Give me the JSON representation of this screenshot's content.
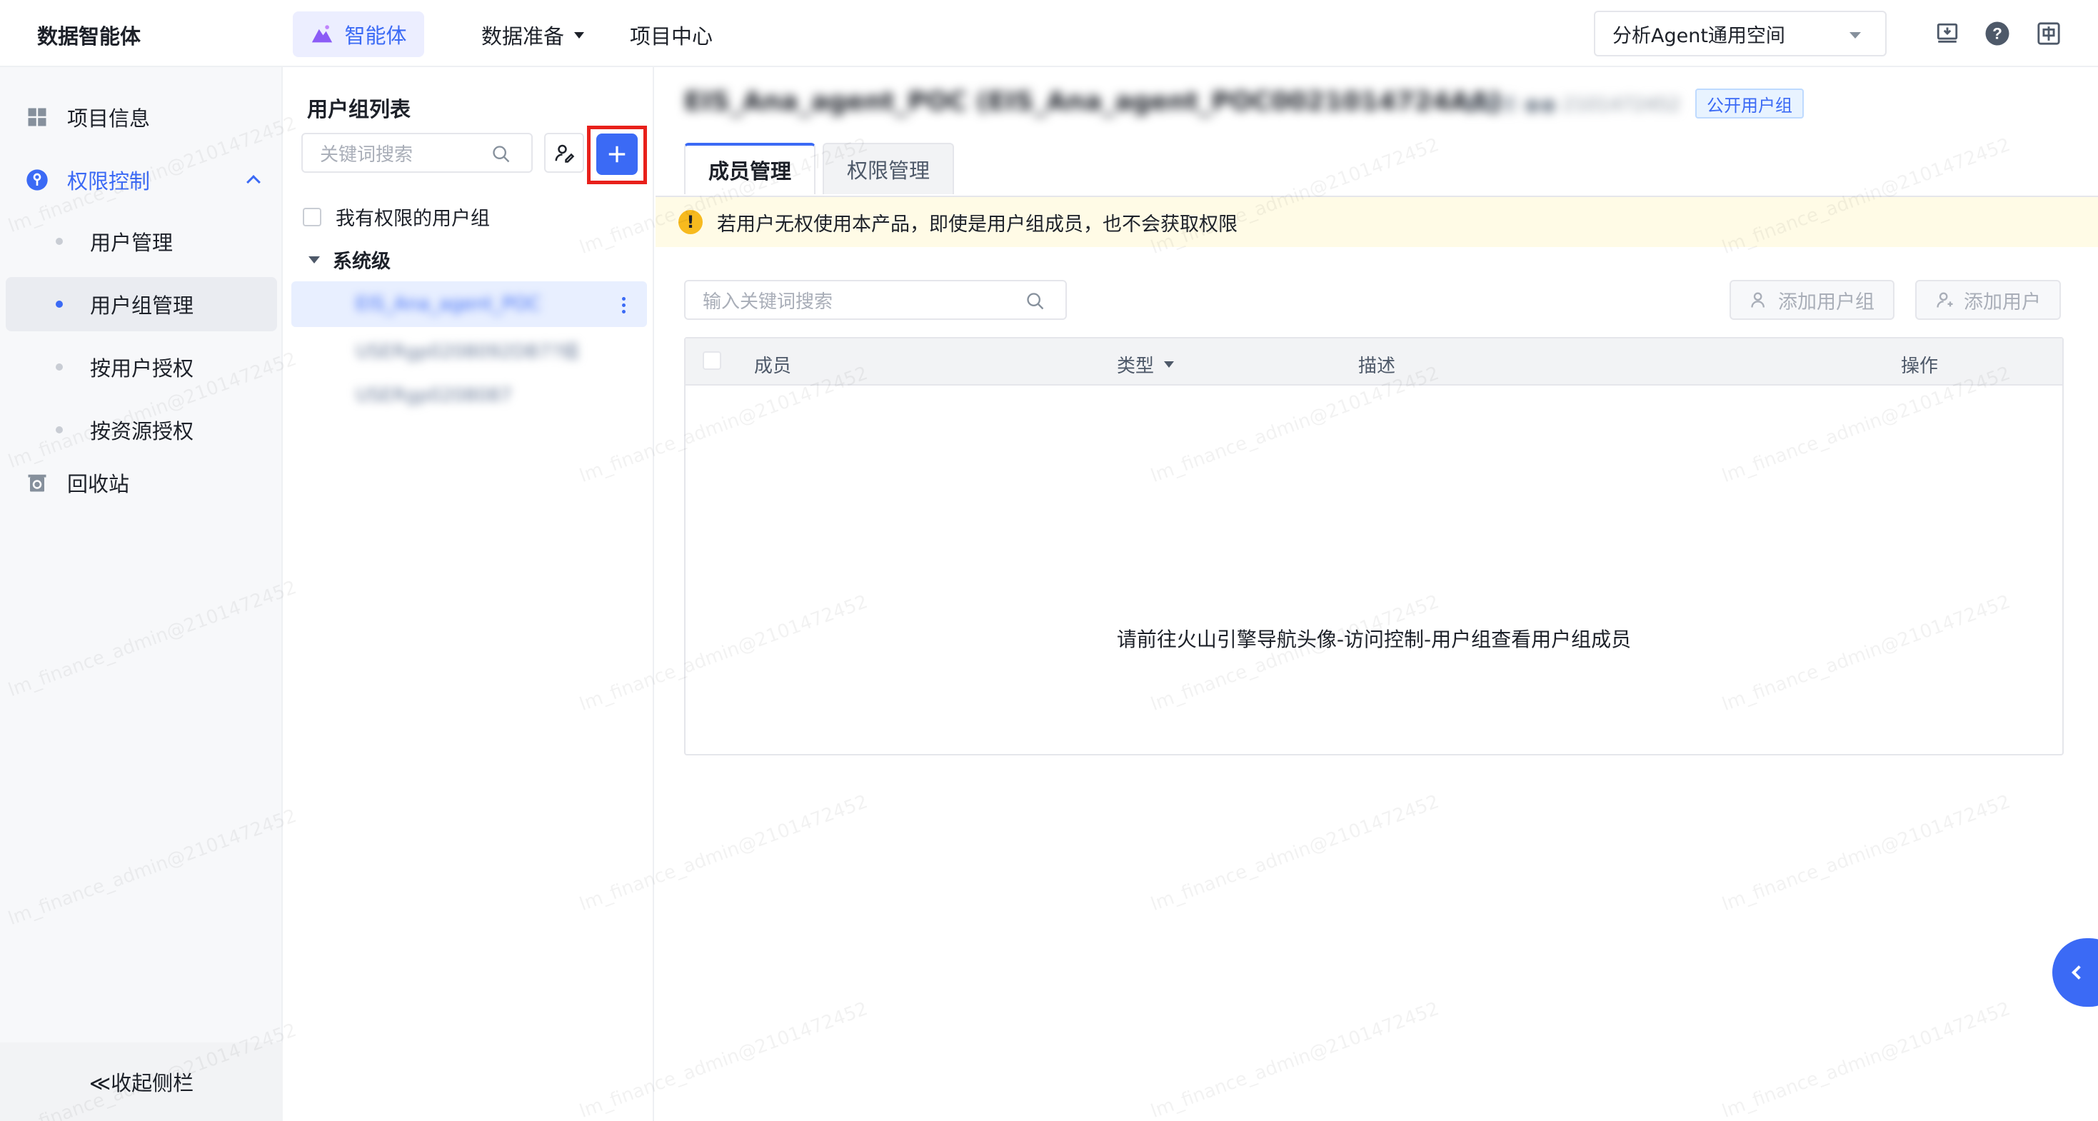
{
  "brand": "数据智能体",
  "nav": {
    "agent": "智能体",
    "data_prep": "数据准备",
    "project_center": "项目中心"
  },
  "workspace": "分析Agent通用空间",
  "top_icons": [
    "download-icon",
    "help-icon",
    "language-icon"
  ],
  "sidebar": {
    "project_info": "项目信息",
    "access_control": "权限控制",
    "user_management": "用户管理",
    "group_management": "用户组管理",
    "authorize_by_user": "按用户授权",
    "authorize_by_resource": "按资源授权",
    "recycle_bin": "回收站",
    "collapse": "≪收起侧栏"
  },
  "group_panel": {
    "title": "用户组列表",
    "search_placeholder": "关键词搜索",
    "my_groups_label": "我有权限的用户组",
    "level_label": "系统级",
    "groups": [
      "EIS_Ana_agent_POC",
      "USERgp0208092DB7?组",
      "USERgp0208087"
    ]
  },
  "detail": {
    "title": "EIS_Ana_agent_POC (EIS_Ana_agent_POC0021014724AA)",
    "meta": "创建者 ●●  2101472452",
    "public_tag": "公开用户组",
    "tabs": [
      "成员管理",
      "权限管理"
    ],
    "warning": "若用户无权使用本产品，即使是用户组成员，也不会获取权限",
    "search_placeholder": "输入关键词搜索",
    "add_group_button": "添加用户组",
    "add_user_button": "添加用户",
    "columns": [
      "成员",
      "类型",
      "描述",
      "操作"
    ],
    "empty_message": "请前往火山引擎导航头像-访问控制-用户组查看用户组成员"
  },
  "watermark": "lm_finance_admin@2101472452",
  "colors": {
    "primary": "#3b6af5",
    "highlight_box": "#e8201b",
    "warning_bg": "#fffbe6",
    "warning_icon": "#f7ba1e"
  }
}
